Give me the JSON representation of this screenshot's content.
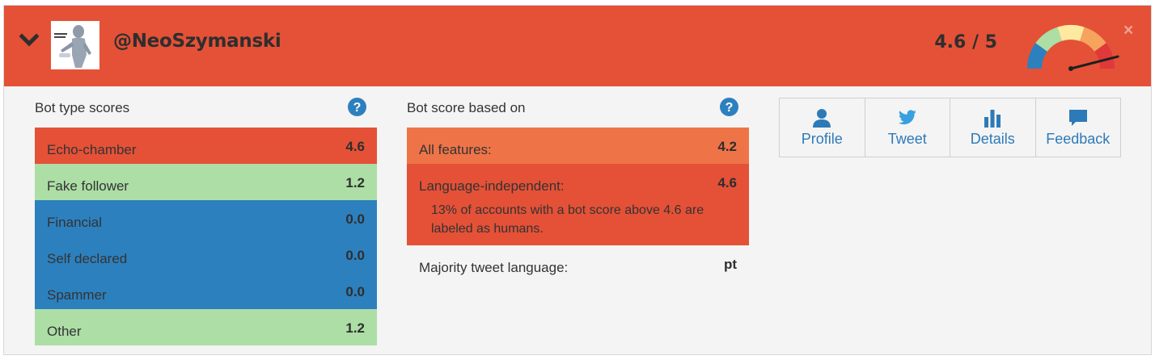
{
  "header": {
    "handle": "@NeoSzymanski",
    "score_display": "4.6 / 5",
    "score": 4.6,
    "max_score": 5,
    "close_label": "×",
    "chevron_icon": "chevron-down-icon",
    "colors": {
      "header_bg": "#e45137"
    }
  },
  "bot_type": {
    "title": "Bot type scores",
    "help_icon": "question-circle-icon",
    "rows": [
      {
        "label": "Echo-chamber",
        "value": "4.6",
        "color": "#e45137"
      },
      {
        "label": "Fake follower",
        "value": "1.2",
        "color": "#acdea6"
      },
      {
        "label": "Financial",
        "value": "0.0",
        "color": "#2d80be"
      },
      {
        "label": "Self declared",
        "value": "0.0",
        "color": "#2d80be"
      },
      {
        "label": "Spammer",
        "value": "0.0",
        "color": "#2d80be"
      },
      {
        "label": "Other",
        "value": "1.2",
        "color": "#acdea6"
      }
    ]
  },
  "bot_score": {
    "title": "Bot score based on",
    "help_icon": "question-circle-icon",
    "all_features": {
      "label": "All features:",
      "value": "4.2",
      "color": "#ee7448"
    },
    "language_independent": {
      "label": "Language-independent:",
      "value": "4.6",
      "note": "13% of accounts with a bot score above 4.6 are labeled as humans.",
      "color": "#e45137"
    },
    "majority_language": {
      "label": "Majority tweet language:",
      "value": "pt"
    }
  },
  "actions": [
    {
      "label": "Profile",
      "icon": "user-icon"
    },
    {
      "label": "Tweet",
      "icon": "twitter-bird-icon"
    },
    {
      "label": "Details",
      "icon": "bar-chart-icon"
    },
    {
      "label": "Feedback",
      "icon": "comment-icon"
    }
  ]
}
